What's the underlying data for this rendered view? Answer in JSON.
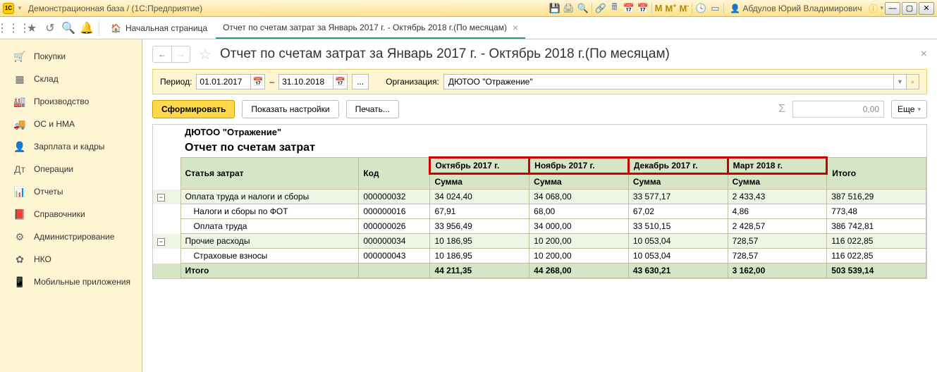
{
  "titlebar": {
    "logo": "1C",
    "title": "Демонстрационная база / (1С:Предприятие)",
    "user": "Абдулов Юрий Владимирович"
  },
  "tabs": {
    "home": "Начальная страница",
    "report": "Отчет по счетам затрат за Январь 2017 г. - Октябрь 2018 г.(По месяцам)"
  },
  "sidebar": {
    "items": [
      {
        "icon": "🛒",
        "label": "Покупки"
      },
      {
        "icon": "▦",
        "label": "Склад"
      },
      {
        "icon": "🏭",
        "label": "Производство"
      },
      {
        "icon": "🚚",
        "label": "ОС и НМА"
      },
      {
        "icon": "👤",
        "label": "Зарплата и кадры"
      },
      {
        "icon": "Дт",
        "label": "Операции"
      },
      {
        "icon": "📊",
        "label": "Отчеты"
      },
      {
        "icon": "📕",
        "label": "Справочники"
      },
      {
        "icon": "⚙",
        "label": "Администрирование"
      },
      {
        "icon": "✿",
        "label": "НКО"
      },
      {
        "icon": "📱",
        "label": "Мобильные приложения"
      }
    ]
  },
  "page": {
    "title": "Отчет по счетам затрат за Январь 2017 г. - Октябрь 2018 г.(По месяцам)"
  },
  "params": {
    "period_label": "Период:",
    "date_from": "01.01.2017",
    "date_to": "31.10.2018",
    "dots": "...",
    "org_label": "Организация:",
    "org_value": "ДЮТОО \"Отражение\""
  },
  "actions": {
    "form": "Сформировать",
    "settings": "Показать настройки",
    "print": "Печать...",
    "sum": "0,00",
    "more": "Еще"
  },
  "report": {
    "subtitle": "ДЮТОО \"Отражение\"",
    "title": "Отчет по счетам затрат",
    "headers": {
      "article": "Статья затрат",
      "code": "Код",
      "months": [
        "Октябрь 2017 г.",
        "Ноябрь 2017 г.",
        "Декабрь 2017 г.",
        "Март 2018 г."
      ],
      "sum": "Сумма",
      "total": "Итого"
    },
    "rows": [
      {
        "type": "group",
        "name": "Оплата труда и налоги и сборы",
        "code": "000000032",
        "vals": [
          "34 024,40",
          "34 068,00",
          "33 577,17",
          "2 433,43"
        ],
        "total": "387 516,29"
      },
      {
        "type": "detail",
        "name": "Налоги и сборы по ФОТ",
        "code": "000000016",
        "vals": [
          "67,91",
          "68,00",
          "67,02",
          "4,86"
        ],
        "total": "773,48"
      },
      {
        "type": "detail",
        "name": "Оплата труда",
        "code": "000000026",
        "vals": [
          "33 956,49",
          "34 000,00",
          "33 510,15",
          "2 428,57"
        ],
        "total": "386 742,81"
      },
      {
        "type": "group",
        "name": "Прочие расходы",
        "code": "000000034",
        "vals": [
          "10 186,95",
          "10 200,00",
          "10 053,04",
          "728,57"
        ],
        "total": "116 022,85"
      },
      {
        "type": "detail",
        "name": "Страховые взносы",
        "code": "000000043",
        "vals": [
          "10 186,95",
          "10 200,00",
          "10 053,04",
          "728,57"
        ],
        "total": "116 022,85"
      },
      {
        "type": "total",
        "name": "Итого",
        "code": "",
        "vals": [
          "44 211,35",
          "44 268,00",
          "43 630,21",
          "3 162,00"
        ],
        "total": "503 539,14"
      }
    ]
  }
}
